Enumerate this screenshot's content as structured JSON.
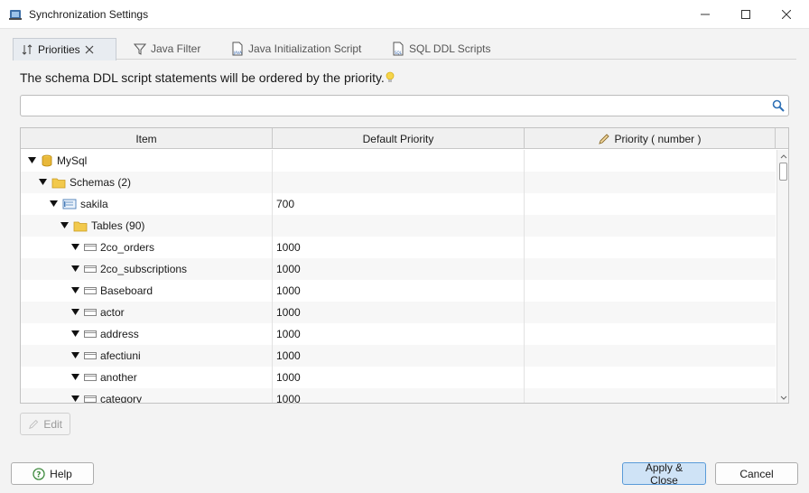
{
  "window": {
    "title": "Synchronization Settings"
  },
  "tabs": [
    {
      "label": "Priorities",
      "active": true,
      "icon": "sort-priority-icon"
    },
    {
      "label": "Java Filter",
      "active": false,
      "icon": "filter-icon"
    },
    {
      "label": "Java Initialization Script",
      "active": false,
      "icon": "java-file-icon"
    },
    {
      "label": "SQL DDL Scripts",
      "active": false,
      "icon": "sql-file-icon"
    }
  ],
  "description": "The schema DDL script statements will be ordered by the priority.",
  "search": {
    "value": "",
    "placeholder": ""
  },
  "table": {
    "columns": [
      "Item",
      "Default Priority",
      "Priority ( number )"
    ],
    "rows": [
      {
        "label": "MySql",
        "default": "",
        "priority": "",
        "level": 0,
        "icon": "database-icon"
      },
      {
        "label": "Schemas (2)",
        "default": "",
        "priority": "",
        "level": 1,
        "icon": "folder-icon"
      },
      {
        "label": "sakila",
        "default": "700",
        "priority": "",
        "level": 2,
        "icon": "schema-icon"
      },
      {
        "label": "Tables (90)",
        "default": "",
        "priority": "",
        "level": 3,
        "icon": "folder-icon"
      },
      {
        "label": "2co_orders",
        "default": "1000",
        "priority": "",
        "level": 4,
        "icon": "table-icon"
      },
      {
        "label": "2co_subscriptions",
        "default": "1000",
        "priority": "",
        "level": 4,
        "icon": "table-icon"
      },
      {
        "label": "Baseboard",
        "default": "1000",
        "priority": "",
        "level": 4,
        "icon": "table-icon"
      },
      {
        "label": "actor",
        "default": "1000",
        "priority": "",
        "level": 4,
        "icon": "table-icon"
      },
      {
        "label": "address",
        "default": "1000",
        "priority": "",
        "level": 4,
        "icon": "table-icon"
      },
      {
        "label": "afectiuni",
        "default": "1000",
        "priority": "",
        "level": 4,
        "icon": "table-icon"
      },
      {
        "label": "another",
        "default": "1000",
        "priority": "",
        "level": 4,
        "icon": "table-icon"
      },
      {
        "label": "category",
        "default": "1000",
        "priority": "",
        "level": 4,
        "icon": "table-icon"
      }
    ]
  },
  "buttons": {
    "edit": "Edit",
    "help": "Help",
    "apply": "Apply & Close",
    "cancel": "Cancel"
  },
  "colors": {
    "accent": "#5a9bd8",
    "apply_bg": "#cfe3f6",
    "folder": "#e8b83a",
    "database": "#d9a520"
  }
}
